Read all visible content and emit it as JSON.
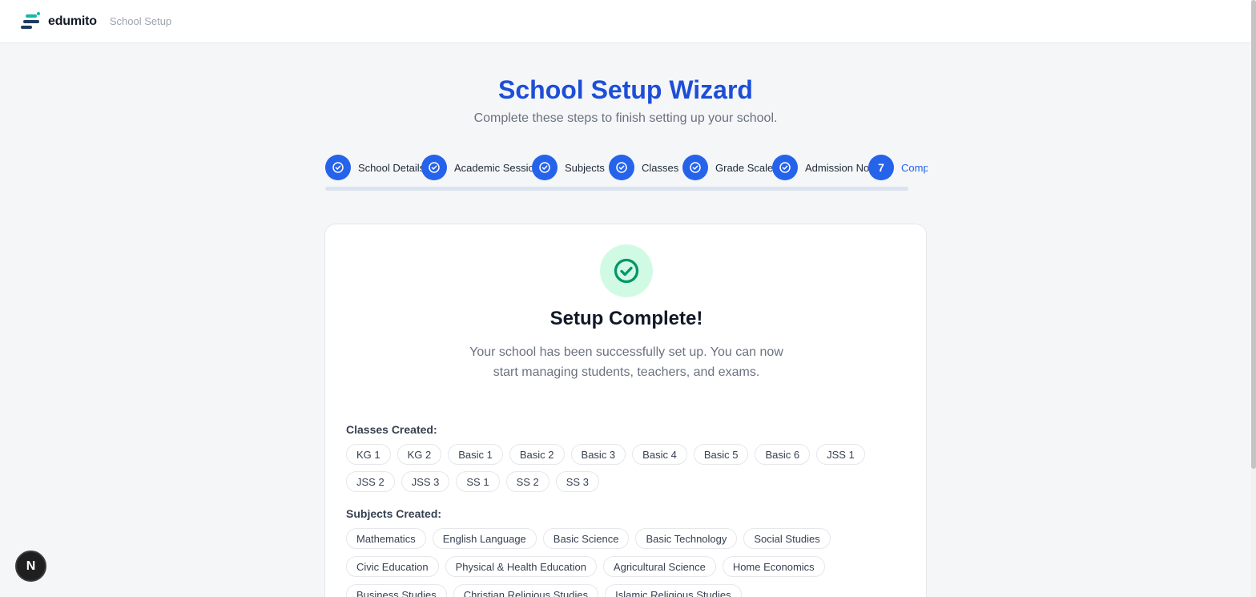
{
  "header": {
    "brand": "edumito",
    "section": "School Setup"
  },
  "wizard": {
    "title": "School Setup Wizard",
    "subtitle": "Complete these steps to finish setting up your school.",
    "steps": [
      {
        "label": "School Details",
        "status": "done"
      },
      {
        "label": "Academic Session",
        "status": "done"
      },
      {
        "label": "Subjects",
        "status": "done"
      },
      {
        "label": "Classes",
        "status": "done"
      },
      {
        "label": "Grade Scale",
        "status": "done"
      },
      {
        "label": "Admission No",
        "status": "done"
      },
      {
        "number": "7",
        "label": "Complete",
        "status": "active"
      }
    ]
  },
  "card": {
    "title": "Setup Complete!",
    "description": "Your school has been successfully set up. You can now start managing students, teachers, and exams.",
    "classes_label": "Classes Created:",
    "classes": [
      "KG 1",
      "KG 2",
      "Basic 1",
      "Basic 2",
      "Basic 3",
      "Basic 4",
      "Basic 5",
      "Basic 6",
      "JSS 1",
      "JSS 2",
      "JSS 3",
      "SS 1",
      "SS 2",
      "SS 3"
    ],
    "subjects_label": "Subjects Created:",
    "subjects": [
      "Mathematics",
      "English Language",
      "Basic Science",
      "Basic Technology",
      "Social Studies",
      "Civic Education",
      "Physical & Health Education",
      "Agricultural Science",
      "Home Economics",
      "Business Studies",
      "Christian Religious Studies",
      "Islamic Religious Studies"
    ]
  },
  "dev_badge": {
    "letter": "N"
  },
  "colors": {
    "primary": "#2563eb",
    "title": "#1d4ed8",
    "success_bg": "#d1fae5",
    "success": "#059669"
  }
}
